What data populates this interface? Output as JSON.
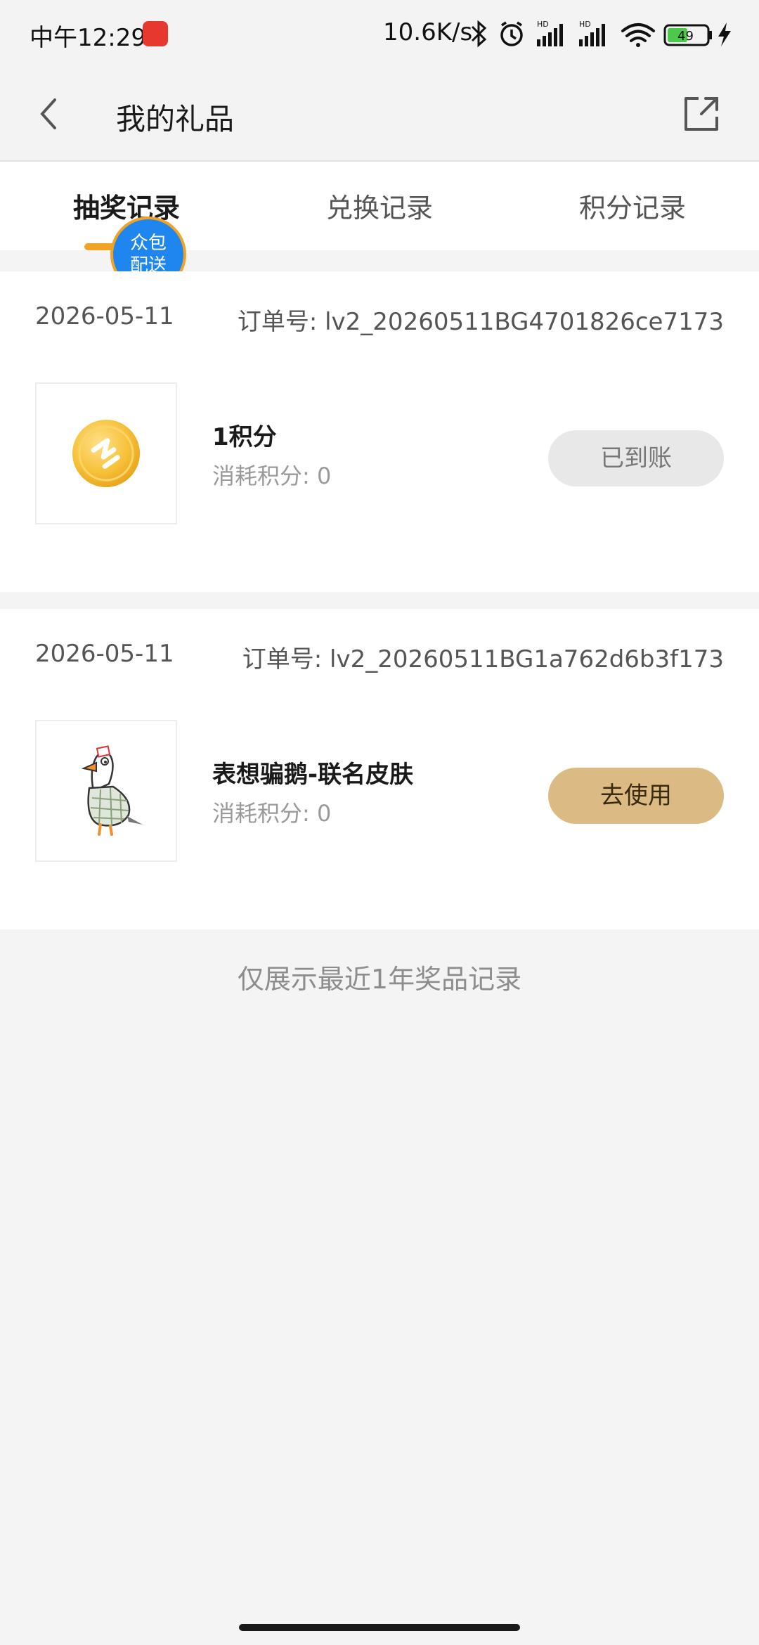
{
  "status_bar": {
    "time": "中午12:29",
    "network_speed": "10.6K/s",
    "battery": "49",
    "icons": [
      "bluetooth-icon",
      "alarm-icon",
      "signal-hd-icon",
      "signal-hd-icon",
      "wifi-icon",
      "battery-icon",
      "charging-icon"
    ]
  },
  "header": {
    "title": "我的礼品",
    "back_icon": "chevron-left-icon",
    "share_icon": "share-external-icon"
  },
  "tabs": [
    {
      "label": "抽奖记录",
      "active": true
    },
    {
      "label": "兑换记录",
      "active": false
    },
    {
      "label": "积分记录",
      "active": false
    }
  ],
  "badge": {
    "line1": "众包",
    "line2": "配送"
  },
  "records": [
    {
      "date": "2026-05-11",
      "order": "订单号: lv2_20260511BG4701826ce7173",
      "name": "1积分",
      "cost": "消耗积分: 0",
      "button": "已到账",
      "icon": "gold-coin-icon"
    },
    {
      "date": "2026-05-11",
      "order": "订单号: lv2_20260511BG1a762d6b3f173",
      "name": "表想骗鹅-联名皮肤",
      "cost": "消耗积分: 0",
      "button": "去使用",
      "icon": "goose-illustration"
    }
  ],
  "footer_note": "仅展示最近1年奖品记录",
  "colors": {
    "accent": "#f0a325",
    "use_button": "#dcba83",
    "badge_blue": "#1f86f0"
  }
}
